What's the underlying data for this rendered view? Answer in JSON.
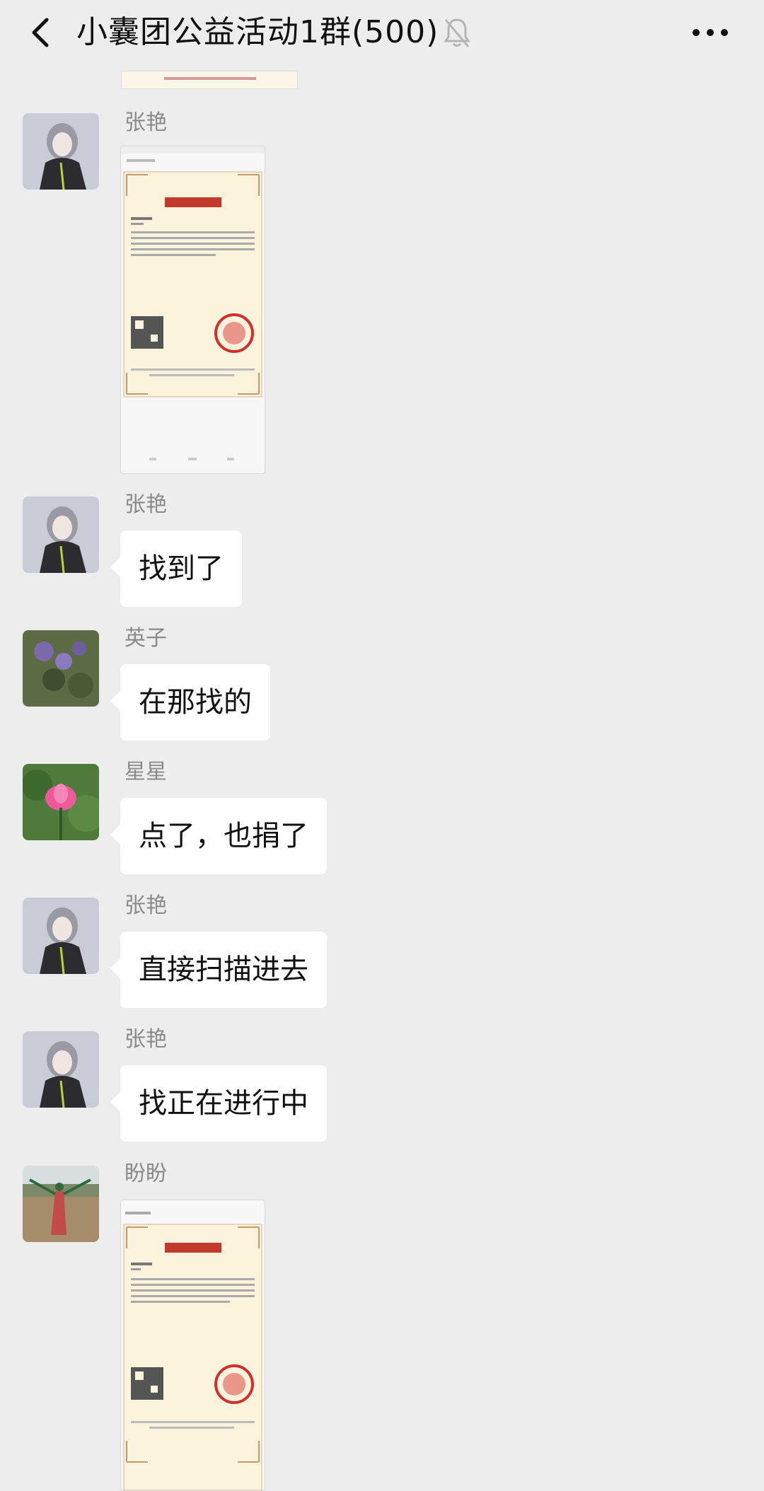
{
  "header": {
    "title": "小囊团公益活动1群(500)",
    "back_icon": "chevron-left-icon",
    "mute_icon": "bell-off-icon",
    "more_icon": "ellipsis-icon"
  },
  "messages": [
    {
      "sender": "张艳",
      "type": "image",
      "avatar": "anime-girl-avatar",
      "image": "certificate-screenshot"
    },
    {
      "sender": "张艳",
      "type": "text",
      "text": "找到了",
      "avatar": "anime-girl-avatar"
    },
    {
      "sender": "英子",
      "type": "text",
      "text": "在那找的",
      "avatar": "purple-flowers-avatar"
    },
    {
      "sender": "星星",
      "type": "text",
      "text": "点了，也捐了",
      "avatar": "lotus-avatar"
    },
    {
      "sender": "张艳",
      "type": "text",
      "text": "直接扫描进去",
      "avatar": "anime-girl-avatar"
    },
    {
      "sender": "张艳",
      "type": "text",
      "text": "找正在进行中",
      "avatar": "anime-girl-avatar"
    },
    {
      "sender": "盼盼",
      "type": "image",
      "avatar": "beach-photo-avatar",
      "image": "certificate-screenshot"
    }
  ],
  "colors": {
    "background": "#ededed",
    "bubble": "#ffffff",
    "sender_name": "#8a8a8a",
    "certificate_red": "#c0392b"
  }
}
